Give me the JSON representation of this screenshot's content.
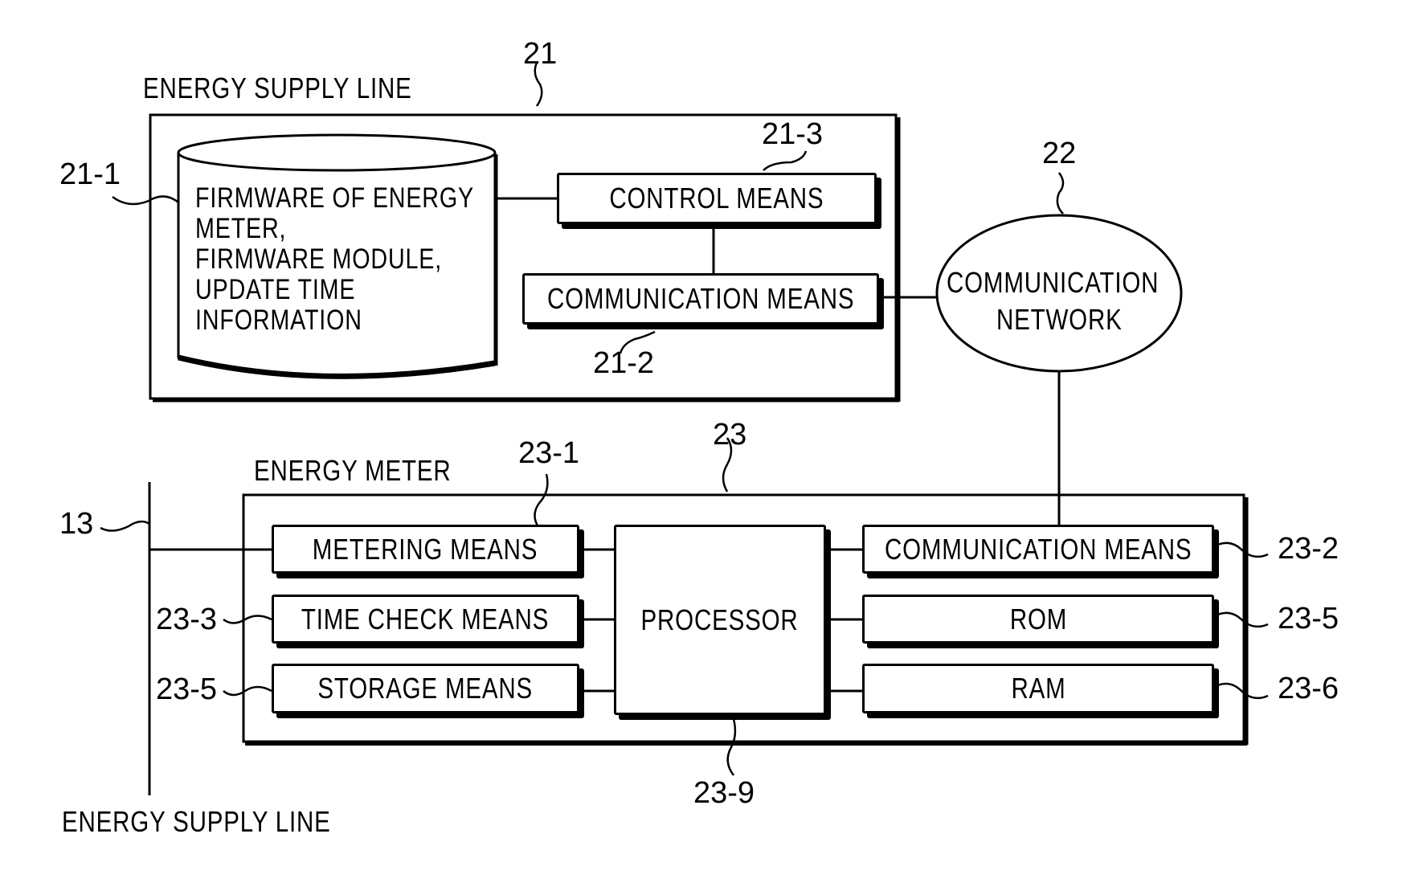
{
  "labels": {
    "supply_line_top": "ENERGY SUPPLY LINE",
    "supply_line_bottom": "ENERGY SUPPLY LINE",
    "energy_meter": "ENERGY METER"
  },
  "server": {
    "ref": "21",
    "database": {
      "ref": "21-1",
      "text": "FIRMWARE OF ENERGY\nMETER,\nFIRMWARE MODULE,\nUPDATE TIME\nINFORMATION"
    },
    "control": {
      "ref": "21-3",
      "label": "CONTROL MEANS"
    },
    "communication": {
      "ref": "21-2",
      "label": "COMMUNICATION MEANS"
    }
  },
  "network": {
    "ref": "22",
    "label_line1": "COMMUNICATION",
    "label_line2": "NETWORK"
  },
  "meter": {
    "ref": "23",
    "supply_ref": "13",
    "metering": {
      "ref": "23-1",
      "label": "METERING MEANS"
    },
    "time_check": {
      "ref": "23-3",
      "label": "TIME CHECK MEANS"
    },
    "storage": {
      "ref": "23-5",
      "label": "STORAGE MEANS"
    },
    "processor": {
      "ref": "23-9",
      "label": "PROCESSOR"
    },
    "communication": {
      "ref": "23-2",
      "label": "COMMUNICATION MEANS"
    },
    "rom": {
      "ref": "23-5",
      "label": "ROM"
    },
    "ram": {
      "ref": "23-6",
      "label": "RAM"
    }
  }
}
